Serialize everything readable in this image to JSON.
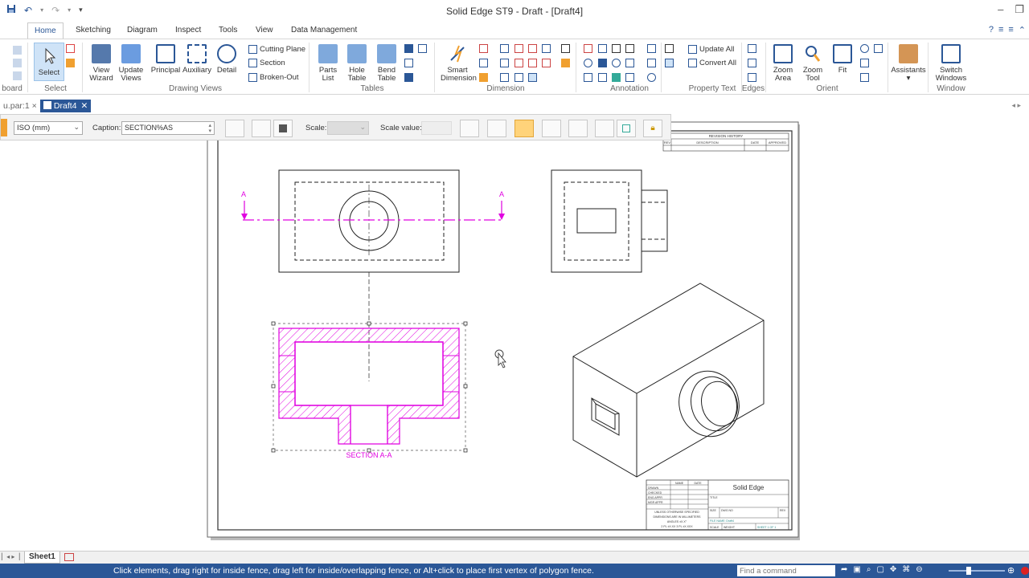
{
  "window": {
    "title": "Solid Edge ST9 - Draft - [Draft4]"
  },
  "ribbon_tabs": [
    "Home",
    "Sketching",
    "Diagram",
    "Inspect",
    "Tools",
    "View",
    "Data Management"
  ],
  "ribbon": {
    "clipboard_label": "board",
    "select": {
      "label": "Select",
      "group": "Select"
    },
    "drawing_views": {
      "group": "Drawing Views",
      "view_wizard": [
        "View",
        "Wizard"
      ],
      "update_views": [
        "Update",
        "Views"
      ],
      "principal": "Principal",
      "auxiliary": "Auxiliary",
      "detail": "Detail",
      "cutting_plane": "Cutting Plane",
      "section": "Section",
      "broken_out": "Broken-Out"
    },
    "tables": {
      "group": "Tables",
      "parts_list": [
        "Parts",
        "List"
      ],
      "hole_table": [
        "Hole",
        "Table"
      ],
      "bend_table": [
        "Bend",
        "Table"
      ]
    },
    "dimension": {
      "group": "Dimension",
      "smart_dimension": [
        "Smart",
        "Dimension"
      ]
    },
    "annotation": {
      "group": "Annotation"
    },
    "property_text": {
      "group": "Property Text",
      "update_all": "Update All",
      "convert_all": "Convert All"
    },
    "edges": {
      "group": "Edges"
    },
    "orient": {
      "group": "Orient",
      "zoom_area": [
        "Zoom",
        "Area"
      ],
      "zoom_tool": [
        "Zoom",
        "Tool"
      ],
      "fit": "Fit"
    },
    "assistants": "Assistants",
    "window": {
      "group": "Window",
      "switch_windows": [
        "Switch",
        "Windows"
      ]
    }
  },
  "doc_tabs": {
    "inactive": "u.par:1",
    "active": "Draft4"
  },
  "command_bar": {
    "standard": "ISO (mm)",
    "caption_label": "Caption:",
    "caption_value": "SECTION%AS",
    "scale_label": "Scale:",
    "scale_value_label": "Scale value:"
  },
  "drawing": {
    "section_label": "SECTION A-A",
    "cutting_plane_letter": "A",
    "title_block": {
      "company": "Solid Edge",
      "revision_history": "REVISION HISTORY",
      "rev": "REV",
      "description": "DESCRIPTION",
      "date": "DATE",
      "approved": "APPROVED",
      "name": "NAME",
      "drawn": "DRAWN",
      "checked": "CHECKED",
      "eng_appr": "ENG APPR",
      "mgr_appr": "MGR APPR",
      "title": "TITLE",
      "size": "SIZE",
      "dwg_no": "DWG NO",
      "rev2": "REV",
      "file_name": "FILE NAME: Draft4",
      "scale": "SCALE",
      "weight": "WEIGHT",
      "sheet": "SHEET 1 OF 1",
      "unless": "UNLESS OTHERWISE SPECIFIED",
      "dims": "DIMENSIONS ARE IN MILLIMETERS",
      "angles": "ANGLES ±X.X°",
      "places": "2 PL ±X.XX 3 PL ±X.XXX"
    }
  },
  "sheets": {
    "active": "Sheet1"
  },
  "status": {
    "message": "Click elements, drag right for inside fence, drag left for inside/overlapping fence, or Alt+click to place first vertex of polygon fence.",
    "command_placeholder": "Find a command"
  },
  "colors": {
    "accent": "#2b5797",
    "magenta": "#e000e0",
    "highlight": "#ffd37a"
  }
}
